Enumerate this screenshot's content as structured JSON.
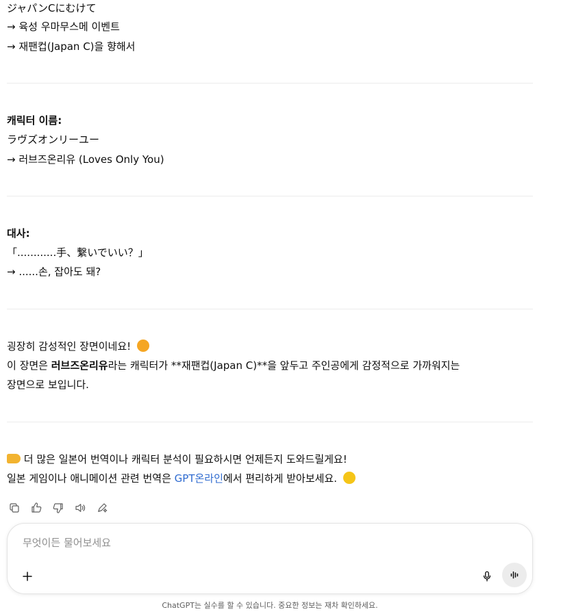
{
  "block1": {
    "jp": "ジャパンCにむけて",
    "tr1": "→ 육성 우마무스메 이벤트",
    "tr2": "→ 재팬컵(Japan C)을 향해서"
  },
  "block2": {
    "heading": "캐릭터 이름:",
    "jp": "ラヴズオンリーユー",
    "tr": "→ 러브즈온리유 (Loves Only You)"
  },
  "block3": {
    "heading": "대사:",
    "jp": "「............手、繋いでいい？」",
    "tr": "→ ......손, 잡아도 돼?"
  },
  "block4": {
    "line1": "굉장히 감성적인 장면이네요!",
    "line1_emoji": "smiling-face-with-hearts",
    "line2_pre": "이 장면은 ",
    "line2_bold": "러브즈온리유",
    "line2_post": "라는 캐릭터가 **재팬컵(Japan C)**을 앞두고 주인공에게 감정적으로 가까워지는",
    "line3": "장면으로 보입니다."
  },
  "block5": {
    "line1_icon": "pointing-hand-emoji",
    "line1": " 더 많은 일본어 번역이나 캐릭터 분석이 필요하시면 언제든지 도와드릴게요!",
    "line2_pre": "일본 게임이나 애니메이션 관련 번역은 ",
    "line2_link": "GPT온라인",
    "line2_post": "에서 편리하게 받아보세요.",
    "line2_emoji": "smiling-face"
  },
  "composer": {
    "placeholder": "무엇이든 물어보세요"
  },
  "footer": {
    "disclaimer": "ChatGPT는 실수를 할 수 있습니다. 중요한 정보는 재차 확인하세요."
  },
  "colors": {
    "text": "#0d0d0d",
    "link": "#2f6bd0",
    "divider": "#ececec",
    "icon": "#5d5d5d"
  }
}
